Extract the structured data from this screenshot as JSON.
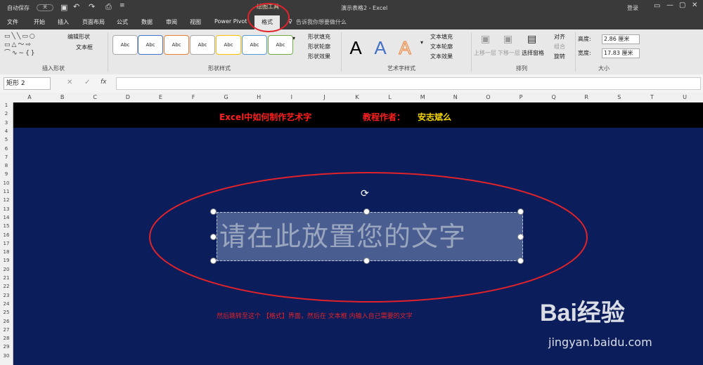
{
  "titlebar": {
    "autosave": "自动保存",
    "autosave_state": "关",
    "context_tab": "绘图工具",
    "doc_title": "演示表格2 - Excel",
    "login": "登录"
  },
  "menu": {
    "items": [
      "文件",
      "开始",
      "插入",
      "页面布局",
      "公式",
      "数据",
      "审阅",
      "视图",
      "Power Pivot",
      "格式"
    ],
    "tell_me": "告诉我你想要做什么"
  },
  "ribbon": {
    "insert_shapes": {
      "label": "插入形状",
      "edit_shape": "编辑形状",
      "text_box": "文本框"
    },
    "shape_styles": {
      "label": "形状样式",
      "sample": "Abc",
      "fill": "形状填充",
      "outline": "形状轮廓",
      "effects": "形状效果"
    },
    "wordart": {
      "label": "艺术字样式",
      "letter": "A",
      "text_fill": "文本填充",
      "text_outline": "文本轮廓",
      "text_effects": "文本效果"
    },
    "arrange": {
      "label": "排列",
      "bring_forward": "上移一层",
      "send_backward": "下移一层",
      "selection_pane": "选择窗格",
      "align": "对齐",
      "group": "组合",
      "rotate": "旋转"
    },
    "size": {
      "label": "大小",
      "height_label": "高度:",
      "height_value": "2.86 厘米",
      "width_label": "宽度:",
      "width_value": "17.83 厘米"
    }
  },
  "formula_bar": {
    "name_box": "矩形 2",
    "fx": "fx",
    "cancel": "✕",
    "enter": "✓"
  },
  "grid": {
    "columns": [
      "A",
      "B",
      "C",
      "D",
      "E",
      "F",
      "G",
      "H",
      "I",
      "J",
      "K",
      "L",
      "M",
      "N",
      "O",
      "P",
      "Q",
      "R",
      "S",
      "T",
      "U"
    ],
    "rows": [
      "1",
      "2",
      "3",
      "4",
      "5",
      "6",
      "7",
      "8",
      "9",
      "10",
      "11",
      "12",
      "13",
      "14",
      "15",
      "16",
      "17",
      "18",
      "19",
      "20",
      "21",
      "22",
      "23",
      "24",
      "25",
      "26",
      "27",
      "28",
      "29",
      "30"
    ]
  },
  "sheet": {
    "headline": "Excel中如何制作艺术字",
    "author_label": "教程作者：",
    "author_name": "安志斌么",
    "textbox_text": "请在此放置您的文字",
    "caption": "然后跳转至这个 【格式】界面，然后在 文本框 内输入自己需要的文字"
  },
  "watermark": {
    "logo": "Bai经验",
    "url": "jingyan.baidu.com"
  },
  "colors": {
    "sheet_bg": "#0b1e5b",
    "headline": "#ff1f1f",
    "author_name": "#f5d800",
    "annotation": "#e0232a",
    "menubar": "#3a3a3a"
  }
}
